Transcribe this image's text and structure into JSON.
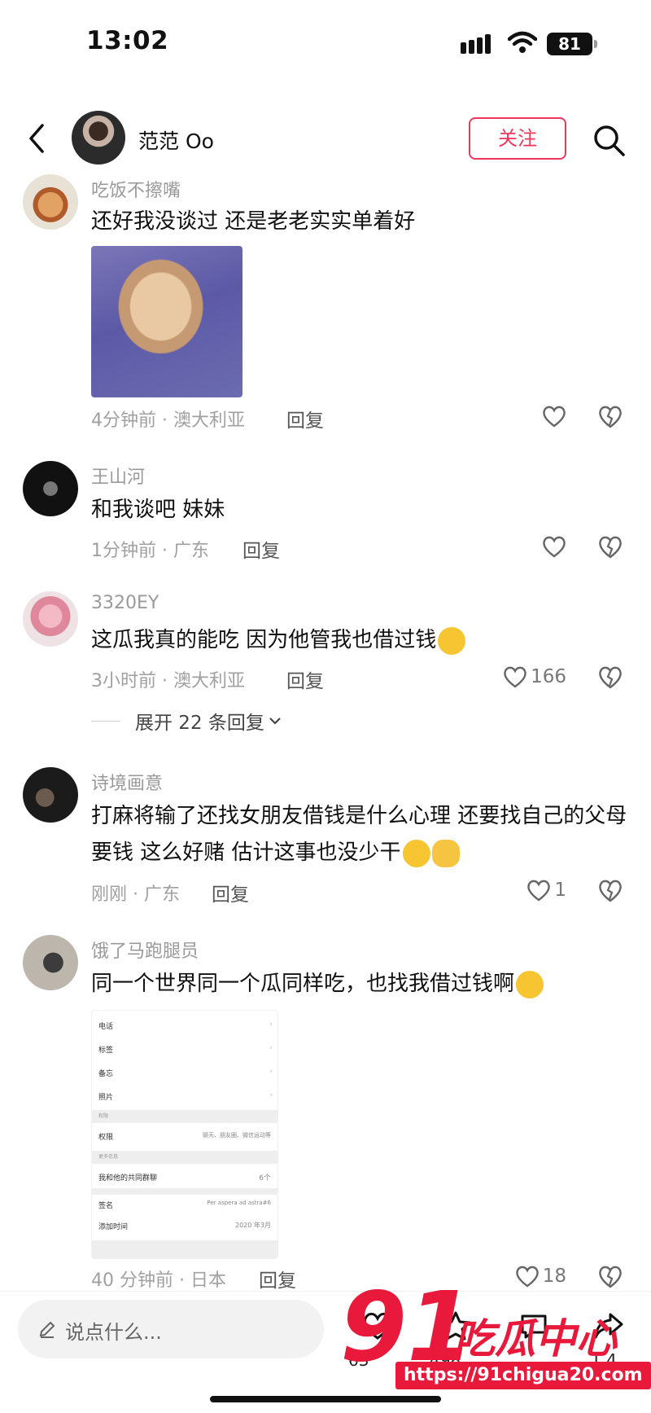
{
  "status_bar": {
    "time": "13:02",
    "battery": "81"
  },
  "header": {
    "name": "范范 Oo",
    "follow_label": "关注"
  },
  "comments": [
    {
      "username": "吃饭不擦嘴",
      "text": "还好我没谈过 还是老老实实单着好",
      "time_location": "4分钟前 · 澳大利亚",
      "reply_label": "回复",
      "likes": ""
    },
    {
      "username": "王山河",
      "text": "和我谈吧 妹妹",
      "time_location": "1分钟前 · 广东",
      "reply_label": "回复",
      "likes": ""
    },
    {
      "username": "3320EY",
      "text": "这瓜我真的能吃 因为他管我也借过钱",
      "time_location": "3小时前 · 澳大利亚",
      "reply_label": "回复",
      "likes": "166",
      "expand_label": "展开 22 条回复"
    },
    {
      "username": "诗境画意",
      "text": "打麻将输了还找女朋友借钱是什么心理 还要找自己的父母要钱  这么好赌 估计这事也没少干",
      "time_location": "刚刚 · 广东",
      "reply_label": "回复",
      "likes": "1"
    },
    {
      "username": "饿了马跑腿员",
      "text": "同一个世界同一个瓜同样吃，也找我借过钱啊",
      "time_location": "40 分钟前 · 日本",
      "reply_label": "回复",
      "likes": "18",
      "screenshot": {
        "rows": [
          "电话",
          "标签",
          "备忘",
          "照片"
        ],
        "section1": "权限",
        "perm_label": "权限",
        "perm_value": "聊天、朋友圈、微信运动等",
        "section2": "更多信息",
        "groups_label": "我和他的共同群聊",
        "groups_value": "6个",
        "signature_label": "签名",
        "signature_value": "Per aspera ad astra#6",
        "added_label": "添加时间",
        "added_value": "2020 年3月"
      }
    }
  ],
  "bottom_bar": {
    "placeholder": "说点什么...",
    "like_count": "63",
    "star_count": "498",
    "comment_count": "1.4"
  },
  "watermark": {
    "brand": "91",
    "text": "吃瓜中心",
    "url": "https://91chigua20.com"
  },
  "colors": {
    "accent": "#f2365b",
    "watermark": "#e8193a"
  }
}
